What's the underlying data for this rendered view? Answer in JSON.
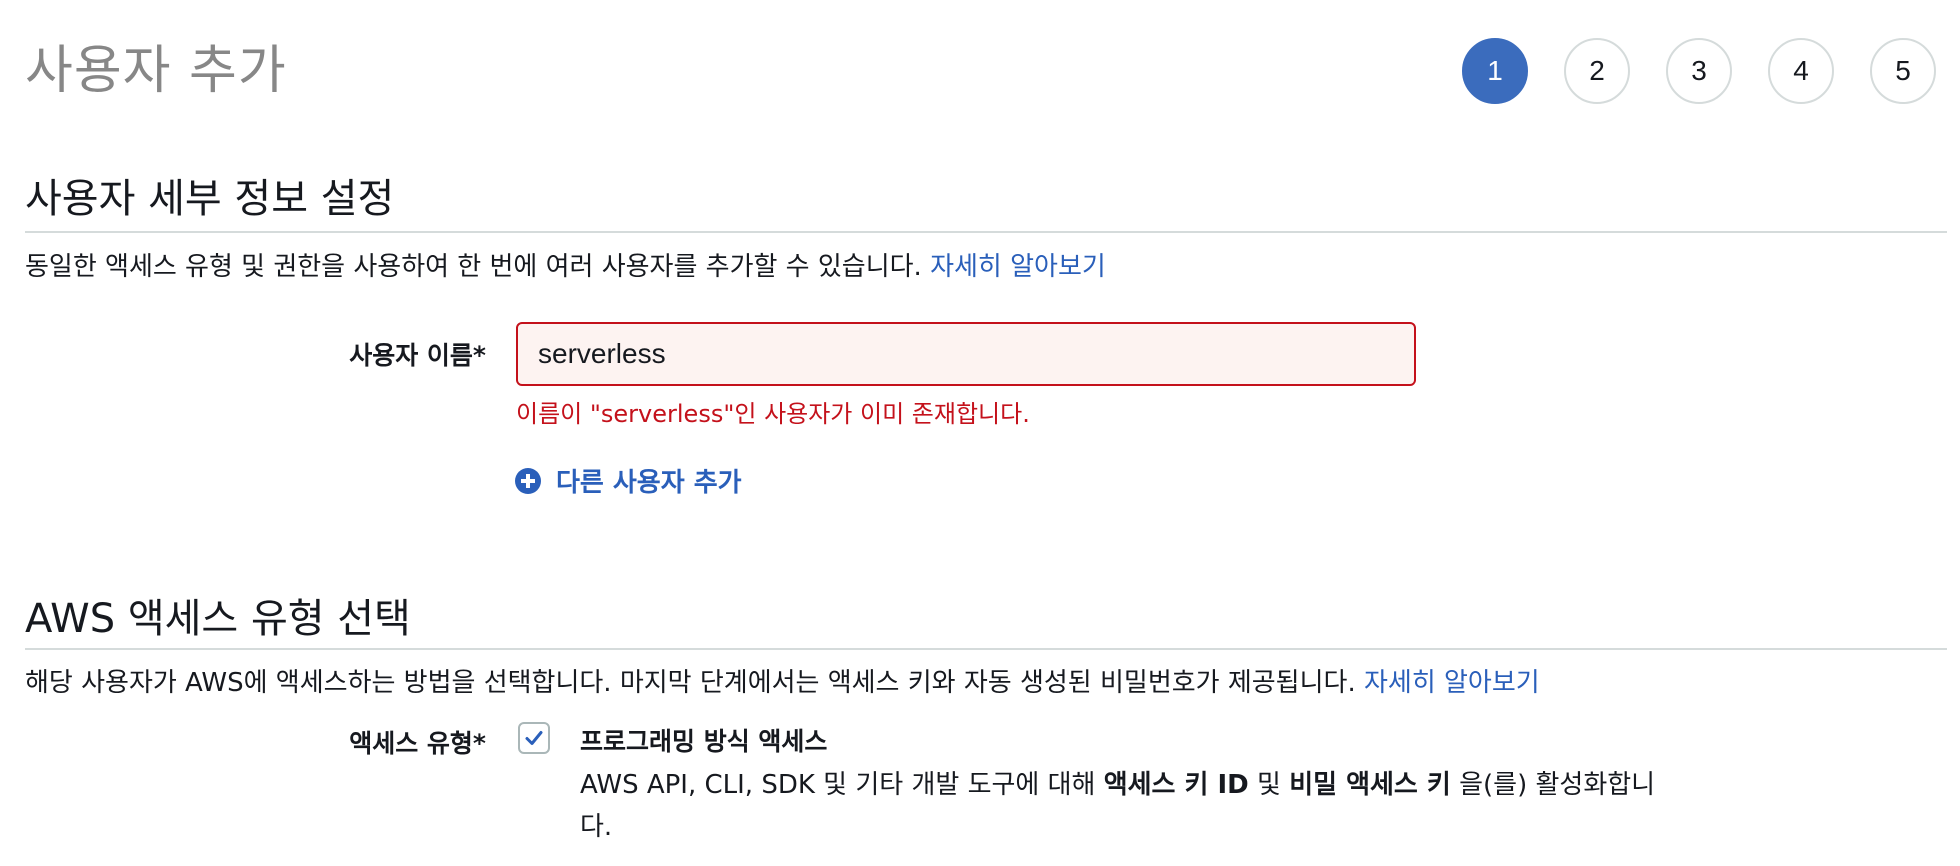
{
  "header": {
    "title": "사용자 추가"
  },
  "steps": [
    "1",
    "2",
    "3",
    "4",
    "5"
  ],
  "user_details": {
    "title": "사용자 세부 정보 설정",
    "description": "동일한 액세스 유형 및 권한을 사용하여 한 번에 여러 사용자를 추가할 수 있습니다. ",
    "learn_more": "자세히 알아보기",
    "username_label": "사용자 이름*",
    "username_value": "serverless",
    "error": "이름이 \"serverless\"인 사용자가 이미 존재합니다.",
    "add_another": "다른 사용자 추가"
  },
  "access_type": {
    "title": "AWS 액세스 유형 선택",
    "description": "해당 사용자가 AWS에 액세스하는 방법을 선택합니다. 마지막 단계에서는 액세스 키와 자동 생성된 비밀번호가 제공됩니다. ",
    "learn_more": "자세히 알아보기",
    "label": "액세스 유형*",
    "option_title": "프로그래밍 방식 액세스",
    "option_desc_1": "AWS API, CLI, SDK 및 기타 개발 도구에 대해 ",
    "option_desc_bold_1": "액세스 키 ID",
    "option_desc_2": " 및 ",
    "option_desc_bold_2": "비밀 액세스 키",
    "option_desc_3": " 을(를) 활성화합니다.",
    "checked": true
  },
  "colors": {
    "accent": "#3b6cbd",
    "link": "#2a5fba",
    "error": "#c4111b",
    "error_bg": "#fdf3f1",
    "divider": "#d5dbdb"
  }
}
